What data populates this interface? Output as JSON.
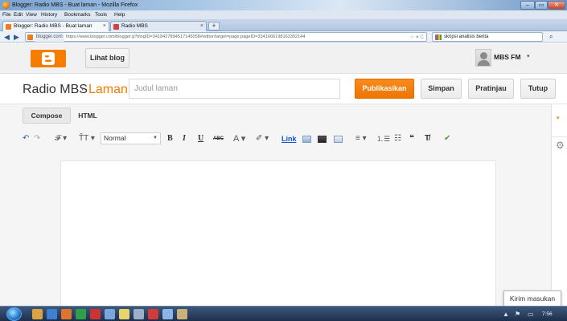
{
  "browser": {
    "window_title": "Blogger: Radio MBS - Buat laman - Mozilla Firefox",
    "window_buttons": {
      "minimize": "–",
      "maximize": "▭",
      "close": "✕"
    },
    "menu": [
      "File",
      "Edit",
      "View",
      "History",
      "Bookmarks",
      "Tools",
      "Help"
    ],
    "tabs": [
      {
        "label": "Blogger: Radio MBS - Buat laman",
        "active": true,
        "close": "×"
      },
      {
        "label": "Radio MBS",
        "active": false,
        "close": "×"
      }
    ],
    "new_tab": "+",
    "nav": {
      "back": "◀",
      "forward": "▶"
    },
    "site_identity": "blogger.com",
    "url": "https://www.blogger.com/blogger.g?blogID=3418427894517145058#editor/target=page;pageID=3341666198163392144",
    "url_controls": "☆ ▾ C",
    "search_text": "skripsi analisis berita",
    "search_icon": "search-icon"
  },
  "header": {
    "view_blog_label": "Lihat blog",
    "user_name": "MBS FM",
    "user_caret": "▾"
  },
  "page_bar": {
    "blog_name": "Radio MBS",
    "separator": "·",
    "page_type": "Laman",
    "title_placeholder": "Judul laman",
    "publish_label": "Publikasikan",
    "save_label": "Simpan",
    "preview_label": "Pratinjau",
    "close_label": "Tutup"
  },
  "editor": {
    "mode_tabs": [
      "Compose",
      "HTML"
    ],
    "toolbar": {
      "undo": "↶",
      "redo": "↷",
      "font": "𝓕 ▾",
      "text_size": "T̂T ▾",
      "format_value": "Normal",
      "bold": "B",
      "italic": "I",
      "underline": "U",
      "strikethrough": "ABC",
      "text_color": "A ▾",
      "highlight": "✐ ▾",
      "link": "Link",
      "align": "≡ ▾",
      "numbered_list": "⒈☰",
      "bullet_list": "☷",
      "quote": "❝",
      "clear_format": "T̸",
      "spellcheck": "✔"
    }
  },
  "sidebar": {
    "collapse": "▾",
    "settings": "⚙"
  },
  "feedback_label": "Kirim masukan",
  "taskbar": {
    "clock": "7:56",
    "tray_icons": [
      "▲",
      "⚑",
      "▭"
    ]
  },
  "colors": {
    "accent": "#f57d00",
    "link": "#1155cc",
    "header_bg": "#f1f1f1"
  }
}
